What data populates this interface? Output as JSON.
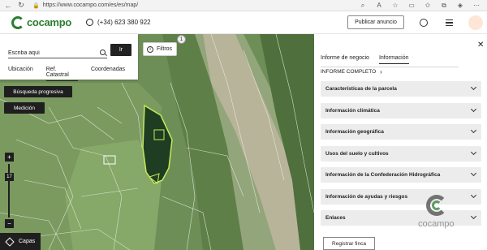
{
  "browser": {
    "url": "https://www.cocampo.com/es/es/map/",
    "nav_icons": [
      "back-arrow-icon",
      "refresh-icon",
      "home-icon"
    ],
    "toolbar_icons": [
      "zoom-icon",
      "read-aloud-icon",
      "favorite-star-icon",
      "split-screen-icon",
      "favorites-icon",
      "collections-icon",
      "extensions-icon",
      "more-icon"
    ]
  },
  "header": {
    "logo_text": "cocampo",
    "phone": "(+34) 623 380 922",
    "publish_label": "Publicar anuncio"
  },
  "search": {
    "placeholder": "Escriba aquí",
    "go_label": "Ir",
    "tabs": [
      {
        "label": "Ubicación",
        "active": false
      },
      {
        "label": "Ref. Catastral",
        "active": true
      },
      {
        "label": "Coordenadas",
        "active": false
      }
    ]
  },
  "map_controls": {
    "filters_label": "Filtros",
    "filters_count": "1",
    "progressive_search_label": "Búsqueda progresiva",
    "measure_label": "Medición",
    "zoom_in": "+",
    "zoom_out": "−",
    "zoom_level": "17",
    "layers_label": "Capas"
  },
  "panel": {
    "tabs": [
      {
        "label": "Informe de negocio",
        "active": false
      },
      {
        "label": "Información",
        "active": true
      }
    ],
    "report_label": "INFORME COMPLETO",
    "sections": [
      "Características de la parcela",
      "Información climática",
      "Información geográfica",
      "Usos del suelo y cultivos",
      "Información de la Confederación Hidrográfica",
      "Información de ayudas y riesgos",
      "Enlaces"
    ],
    "watermark_text": "cocampo",
    "register_label": "Registrar finca"
  },
  "colors": {
    "brand_green": "#2e7d32",
    "dark_button": "#1f1f1f",
    "accordion_bg": "#ececec"
  }
}
